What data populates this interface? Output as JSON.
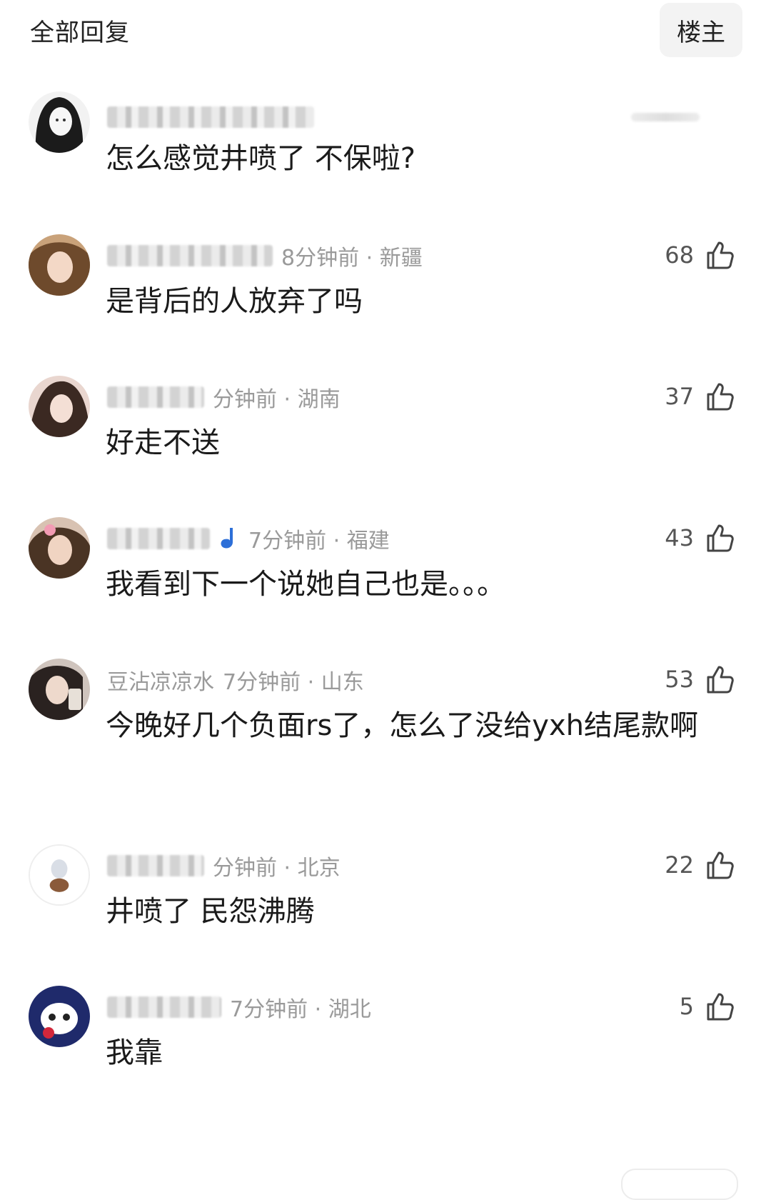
{
  "header": {
    "title": "全部回复",
    "op_button": "楼主"
  },
  "colors": {
    "meta": "#9a9a9a",
    "text": "#1a1a1a",
    "like": "#555555"
  },
  "comments": [
    {
      "meta": "",
      "likes": "",
      "text": "怎么感觉井喷了 不保啦?"
    },
    {
      "meta": "8分钟前 · 新疆",
      "likes": "68",
      "text": "是背后的人放弃了吗"
    },
    {
      "meta": "分钟前 · 湖南",
      "likes": "37",
      "text": "好走不送"
    },
    {
      "meta": "7分钟前 · 福建",
      "likes": "43",
      "text": "我看到下一个说她自己也是。。。"
    },
    {
      "name": "豆沾凉凉水",
      "meta": "7分钟前 · 山东",
      "likes": "53",
      "text": "今晚好几个负面rs了，怎么了没给yxh结尾款啊"
    },
    {
      "meta": "分钟前 · 北京",
      "likes": "22",
      "text": "井喷了 民怨沸腾"
    },
    {
      "meta": "7分钟前 · 湖北",
      "likes": "5",
      "text": "我靠"
    }
  ],
  "icons": {
    "like": "thumbs-up-icon"
  }
}
